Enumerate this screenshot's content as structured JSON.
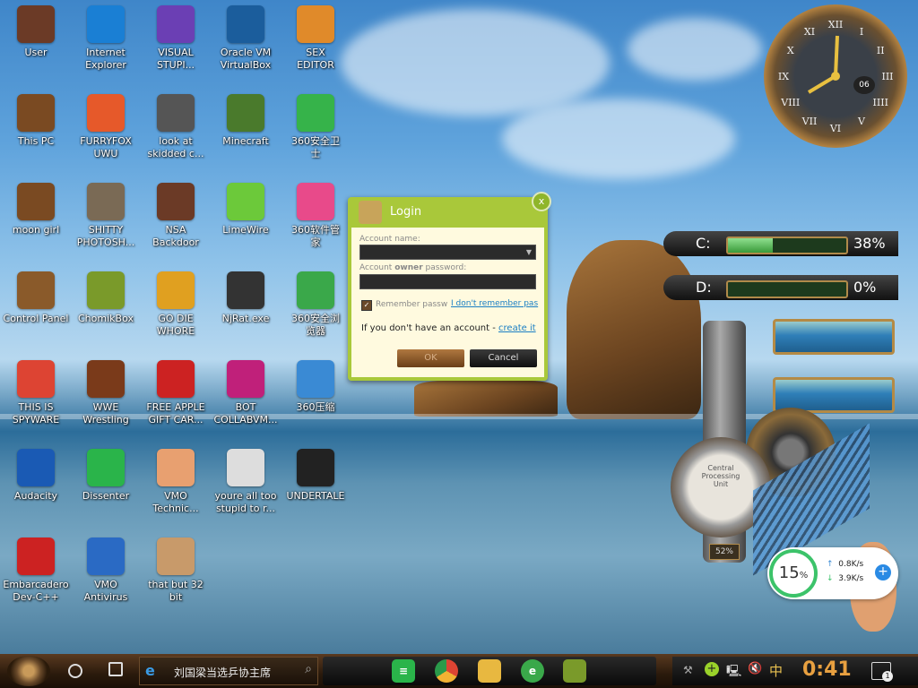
{
  "desktop_icons": [
    {
      "label": "User",
      "icon": "user-folder-icon",
      "color": "#6b3a26"
    },
    {
      "label": "Internet\nExplorer",
      "icon": "edge-icon",
      "color": "#1a7fd4"
    },
    {
      "label": "VISUAL\nSTUPI...",
      "icon": "visual-studio-icon",
      "color": "#6b3fb4"
    },
    {
      "label": "Oracle VM\nVirtualBox",
      "icon": "virtualbox-icon",
      "color": "#1b5d9c"
    },
    {
      "label": "SEX\nEDITOR",
      "icon": "hex-editor-icon",
      "color": "#e08a2a"
    },
    {
      "label": "This PC",
      "icon": "this-pc-icon",
      "color": "#7a4a22"
    },
    {
      "label": "FURRYFOX\nUWU",
      "icon": "firefox-icon",
      "color": "#e6592a"
    },
    {
      "label": "look at\nskidded c...",
      "icon": "pages-icon",
      "color": "#555"
    },
    {
      "label": "Minecraft",
      "icon": "minecraft-icon",
      "color": "#4a7a2c"
    },
    {
      "label": "360安全卫\n士",
      "icon": "360-security-icon",
      "color": "#36b34a"
    },
    {
      "label": "moon girl",
      "icon": "box-icon",
      "color": "#7a4a22"
    },
    {
      "label": "SHITTY\nPHOTOSH...",
      "icon": "gimp-icon",
      "color": "#7a6a55"
    },
    {
      "label": "NSA\nBackdoor",
      "icon": "tv-icon",
      "color": "#6b3a26"
    },
    {
      "label": "LimeWire",
      "icon": "limewire-icon",
      "color": "#6cc93a"
    },
    {
      "label": "360软件管\n家",
      "icon": "360-software-icon",
      "color": "#e84a8a"
    },
    {
      "label": "Control Panel",
      "icon": "control-panel-icon",
      "color": "#8a5a2a"
    },
    {
      "label": "ChomikBox",
      "icon": "chomikbox-icon",
      "color": "#7a9a2a"
    },
    {
      "label": "GO DIE\nWHORE",
      "icon": "de-icon",
      "color": "#e0a020"
    },
    {
      "label": "NjRat.exe",
      "icon": "skull-icon",
      "color": "#333"
    },
    {
      "label": "360安全浏\n览器",
      "icon": "360-browser-icon",
      "color": "#3aa84a"
    },
    {
      "label": "THIS IS\nSPYWARE",
      "icon": "chrome-icon",
      "color": "#dd4433"
    },
    {
      "label": "WWE\nWrestling",
      "icon": "oven-icon",
      "color": "#7a3a1a"
    },
    {
      "label": "FREE APPLE\nGIFT CAR...",
      "icon": "apple-icon",
      "color": "#cc2222"
    },
    {
      "label": "BOT\nCOLLABVM...",
      "icon": "monitor-icon",
      "color": "#c0207a"
    },
    {
      "label": "360压缩",
      "icon": "360-zip-icon",
      "color": "#3a8ad4"
    },
    {
      "label": "Audacity",
      "icon": "audacity-icon",
      "color": "#1a5ab4"
    },
    {
      "label": "Dissenter",
      "icon": "dissenter-icon",
      "color": "#2ab44a"
    },
    {
      "label": "VMO\nTechnic...",
      "icon": "technician-icon",
      "color": "#e8a070"
    },
    {
      "label": "youre all too\nstupid to r...",
      "icon": "portrait-icon",
      "color": "#ddd"
    },
    {
      "label": "UNDERTALE",
      "icon": "unity-icon",
      "color": "#222"
    },
    {
      "label": "Embarcadero\nDev-C++",
      "icon": "devcpp-icon",
      "color": "#cc2222"
    },
    {
      "label": "VMO\nAntivirus",
      "icon": "shield-icon",
      "color": "#2a6ac4"
    },
    {
      "label": "that but 32\nbit",
      "icon": "portrait2-icon",
      "color": "#c89a6a"
    }
  ],
  "login": {
    "title": "Login",
    "close": "x",
    "account_label": "Account name:",
    "password_label_a": "Account ",
    "password_label_b": "owner",
    "password_label_c": " password:",
    "remember": "Remember passw",
    "forgot": "I don't remember pas",
    "noaccount": "If you don't have an account - ",
    "create": "create it",
    "ok": "OK",
    "cancel": "Cancel"
  },
  "clock": {
    "date": "06",
    "numerals": [
      "XII",
      "I",
      "II",
      "III",
      "IIII",
      "V",
      "VI",
      "VII",
      "VIII",
      "IX",
      "X",
      "XI"
    ]
  },
  "drives": [
    {
      "letter": "C:",
      "percent": 38,
      "label": "38%"
    },
    {
      "letter": "D:",
      "percent": 0,
      "label": "0%"
    }
  ],
  "gauge": {
    "title": "Central\nProcessing\nUnit",
    "value": "52%"
  },
  "network": {
    "cpu": "15",
    "unit": "%",
    "up": "0.8K/s",
    "down": "3.9K/s"
  },
  "taskbar": {
    "search_text": "刘国梁当选乒协主席",
    "ime": "中",
    "time": "0:41",
    "notify_count": "1"
  }
}
